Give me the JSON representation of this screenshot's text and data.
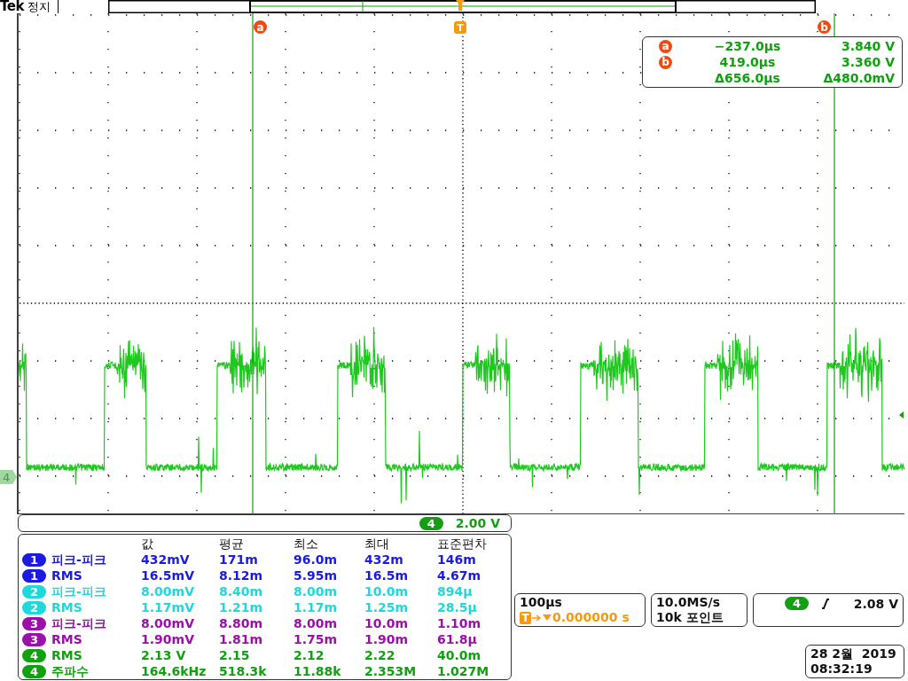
{
  "header": {
    "brand": "Tek",
    "status": "정지"
  },
  "cursor_markers": [
    {
      "label": "a"
    },
    {
      "label": "b"
    }
  ],
  "trigger_marker": "T",
  "channel_marker": "4",
  "cursor_readout": {
    "rows": [
      {
        "label": "a",
        "time": "−237.0µs",
        "voltage": "3.840 V"
      },
      {
        "label": "b",
        "time": "419.0µs",
        "voltage": "3.360 V"
      }
    ],
    "delta_time": "Δ656.0µs",
    "delta_voltage": "Δ480.0mV"
  },
  "channel_scale": {
    "channel": "4",
    "scale": "2.00 V"
  },
  "measurements": {
    "columns": [
      "값",
      "평균",
      "최소",
      "최대",
      "표준편차"
    ],
    "rows": [
      {
        "channel": "1",
        "color": "#1a1ae0",
        "name": "피크-피크",
        "values": [
          "432mV",
          "171m",
          "96.0m",
          "432m",
          "146m"
        ]
      },
      {
        "channel": "1",
        "color": "#1a1ae0",
        "name": "RMS",
        "values": [
          "16.5mV",
          "8.12m",
          "5.95m",
          "16.5m",
          "4.67m"
        ]
      },
      {
        "channel": "2",
        "color": "#20d8dc",
        "name": "피크-피크",
        "values": [
          "8.00mV",
          "8.40m",
          "8.00m",
          "10.0m",
          "894µ"
        ]
      },
      {
        "channel": "2",
        "color": "#20d8dc",
        "name": "RMS",
        "values": [
          "1.17mV",
          "1.21m",
          "1.17m",
          "1.25m",
          "28.5µ"
        ]
      },
      {
        "channel": "3",
        "color": "#9a10a8",
        "name": "피크-피크",
        "values": [
          "8.00mV",
          "8.80m",
          "8.00m",
          "10.0m",
          "1.10m"
        ]
      },
      {
        "channel": "3",
        "color": "#9a10a8",
        "name": "RMS",
        "values": [
          "1.90mV",
          "1.81m",
          "1.75m",
          "1.90m",
          "61.8µ"
        ]
      },
      {
        "channel": "4",
        "color": "#10a010",
        "name": "RMS",
        "values": [
          "2.13 V",
          "2.15",
          "2.12",
          "2.22",
          "40.0m"
        ]
      },
      {
        "channel": "4",
        "color": "#10a010",
        "name": "주파수",
        "values": [
          "164.6kHz",
          "518.3k",
          "11.88k",
          "2.353M",
          "1.027M"
        ]
      }
    ]
  },
  "timebase": {
    "scale": "100µs",
    "trigger_badge": "T",
    "offset": "0.000000 s"
  },
  "acquisition": {
    "rate": "10.0MS/s",
    "points": "10k 포인트"
  },
  "trigger": {
    "channel": "4",
    "level": "2.08 V"
  },
  "date": {
    "date": "28 2월  2019",
    "time": "08:32:19"
  }
}
